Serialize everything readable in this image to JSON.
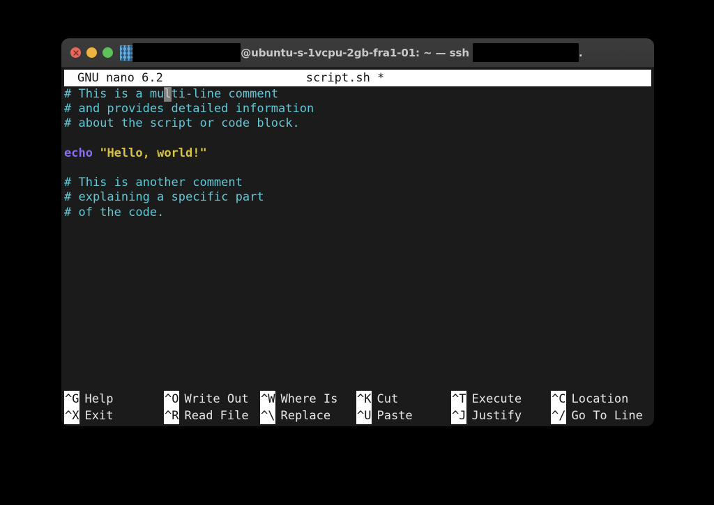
{
  "window": {
    "traffic_lights": [
      {
        "name": "close",
        "color": "#e8695c"
      },
      {
        "name": "minimize",
        "color": "#efb340"
      },
      {
        "name": "maximize",
        "color": "#5ec25a"
      }
    ],
    "app_icon": "folder-icon",
    "title_main": "@ubuntu-s-1vcpu-2gb-fra1-01: ~ — ssh ",
    "title_tail": ".",
    "redacted_user": "",
    "redacted_host": "",
    "titlebar_color": "#3a3a3a"
  },
  "terminal": {
    "background": "#1b1b1b",
    "foreground": "#d8d8d8"
  },
  "nano": {
    "version_label": "GNU nano 6.2",
    "filename": "script.sh *",
    "header_bg": "#ffffff",
    "header_fg": "#141414",
    "colors": {
      "comment": "#5fc9d8",
      "keyword": "#8a6cf0",
      "string": "#d6c344",
      "cursor": "#bebebe"
    },
    "lines": [
      {
        "id": 1,
        "type": "comment",
        "text": "# This is a multi-line comment",
        "cursor_index": 13,
        "segments": [
          {
            "cls": "tok-comment",
            "text": "# This is a mu"
          },
          {
            "cls": "tok-comment cursor-cell",
            "text": "l"
          },
          {
            "cls": "tok-comment",
            "text": "ti-line comment"
          }
        ]
      },
      {
        "id": 2,
        "type": "comment",
        "text": "# and provides detailed information",
        "segments": [
          {
            "cls": "tok-comment",
            "text": "# and provides detailed information"
          }
        ]
      },
      {
        "id": 3,
        "type": "comment",
        "text": "# about the script or code block.",
        "segments": [
          {
            "cls": "tok-comment",
            "text": "# about the script or code block."
          }
        ]
      },
      {
        "id": 4,
        "type": "blank",
        "text": "",
        "segments": []
      },
      {
        "id": 5,
        "type": "code",
        "text": "echo \"Hello, world!\"",
        "segments": [
          {
            "cls": "tok-keyword",
            "text": "echo"
          },
          {
            "cls": "",
            "text": " "
          },
          {
            "cls": "tok-string",
            "text": "\"Hello, world!\""
          }
        ]
      },
      {
        "id": 6,
        "type": "blank",
        "text": "",
        "segments": []
      },
      {
        "id": 7,
        "type": "comment",
        "text": "# This is another comment",
        "segments": [
          {
            "cls": "tok-comment",
            "text": "# This is another comment"
          }
        ]
      },
      {
        "id": 8,
        "type": "comment",
        "text": "# explaining a specific part",
        "segments": [
          {
            "cls": "tok-comment",
            "text": "# explaining a specific part"
          }
        ]
      },
      {
        "id": 9,
        "type": "comment",
        "text": "# of the code.",
        "segments": [
          {
            "cls": "tok-comment",
            "text": "# of the code."
          }
        ]
      }
    ],
    "shortcuts": [
      {
        "top": {
          "key": "^G",
          "label": "Help"
        },
        "bottom": {
          "key": "^X",
          "label": "Exit"
        }
      },
      {
        "top": {
          "key": "^O",
          "label": "Write Out"
        },
        "bottom": {
          "key": "^R",
          "label": "Read File"
        }
      },
      {
        "top": {
          "key": "^W",
          "label": "Where Is"
        },
        "bottom": {
          "key": "^\\",
          "label": "Replace"
        }
      },
      {
        "top": {
          "key": "^K",
          "label": "Cut"
        },
        "bottom": {
          "key": "^U",
          "label": "Paste"
        }
      },
      {
        "top": {
          "key": "^T",
          "label": "Execute"
        },
        "bottom": {
          "key": "^J",
          "label": "Justify"
        }
      },
      {
        "top": {
          "key": "^C",
          "label": "Location"
        },
        "bottom": {
          "key": "^/",
          "label": "Go To Line"
        }
      }
    ]
  }
}
